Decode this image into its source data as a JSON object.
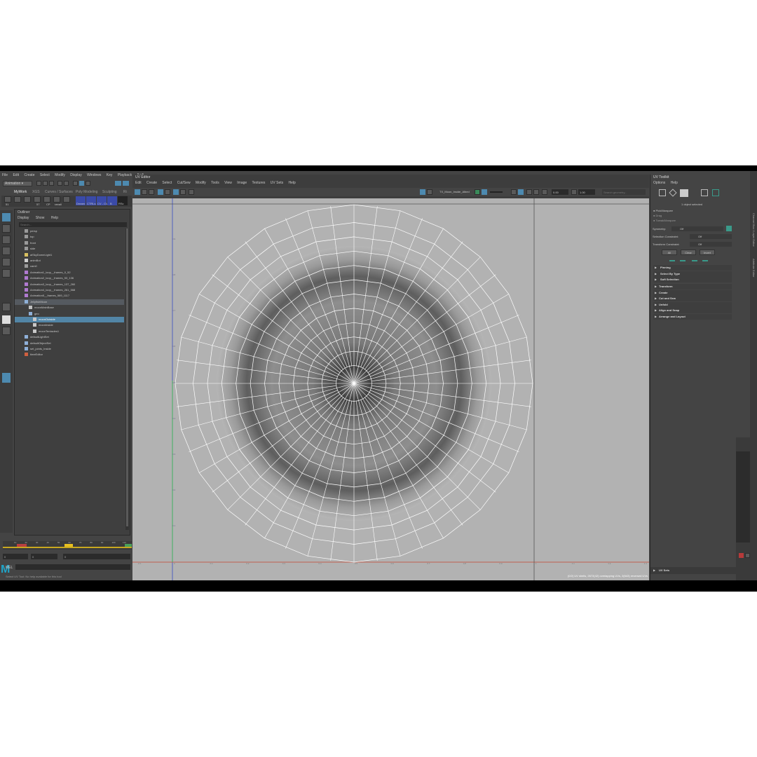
{
  "main_menu": [
    "File",
    "Edit",
    "Create",
    "Select",
    "Modify",
    "Display",
    "Windows",
    "Key",
    "Playback",
    "Audi"
  ],
  "mode_menu": "Animation",
  "shelf_tabs": [
    "MyWork",
    "XGS",
    "Curves / Surfaces",
    "Poly Modeling",
    "Sculpting",
    "Ri"
  ],
  "shelf_buttons": [
    "Dream",
    "CTRLs",
    "CV - CV",
    "B",
    "RSc"
  ],
  "numeric_labels": {
    "a": "51",
    "b": "57",
    "c": "CP",
    "d": "ranall"
  },
  "outliner": {
    "title": "Outliner",
    "menu": [
      "Display",
      "Show",
      "Help"
    ],
    "search_placeholder": "Search...",
    "items": [
      {
        "label": "persp",
        "kind": "camera",
        "indent": 0
      },
      {
        "label": "top",
        "kind": "camera",
        "indent": 0
      },
      {
        "label": "front",
        "kind": "camera",
        "indent": 0
      },
      {
        "label": "side",
        "kind": "camera",
        "indent": 0
      },
      {
        "label": "aiSkyDomeLight1",
        "kind": "light",
        "indent": 0
      },
      {
        "label": "animBot",
        "kind": "magnet",
        "indent": 0
      },
      {
        "label": "cam0",
        "kind": "camera",
        "indent": 0
      },
      {
        "label": "Animation1_loop__frames_0_52",
        "kind": "anim",
        "indent": 0
      },
      {
        "label": "Animation2_loop__frames_53_136",
        "kind": "anim",
        "indent": 0
      },
      {
        "label": "Animation3_loop__frames_137_260",
        "kind": "anim",
        "indent": 0
      },
      {
        "label": "Animation4_loop__frames_261_568",
        "kind": "anim",
        "indent": 0
      },
      {
        "label": "Animation5__frames_569_1117",
        "kind": "anim",
        "indent": 0
      },
      {
        "label": "JellyfishMoon",
        "kind": "group",
        "indent": 0,
        "hl": true
      },
      {
        "label": "moonMainBase",
        "kind": "joint",
        "indent": 1
      },
      {
        "label": "geo",
        "kind": "group",
        "indent": 1
      },
      {
        "label": "moonOutside",
        "kind": "mesh",
        "indent": 2,
        "sel": true
      },
      {
        "label": "moonInside",
        "kind": "mesh",
        "indent": 2
      },
      {
        "label": "moonTentacles1",
        "kind": "mesh",
        "indent": 2
      },
      {
        "label": "defaultLightSet",
        "kind": "set",
        "indent": 0
      },
      {
        "label": "defaultObjectSet",
        "kind": "set",
        "indent": 0
      },
      {
        "label": "set_joints_Inside",
        "kind": "set",
        "indent": 0
      },
      {
        "label": "timeEditor",
        "kind": "time",
        "indent": 0
      }
    ]
  },
  "timeline": {
    "ticks": [
      "10",
      "20",
      "30",
      "40",
      "50",
      "60",
      "70",
      "80",
      "90",
      "100",
      "110"
    ],
    "field_a": "0",
    "field_b": "0",
    "field_c": "0"
  },
  "mel_label": "MEL",
  "help_line": "Select UV Tool: No help available for this tool",
  "uv_editor": {
    "title": "UV Editor",
    "menu": [
      "Edit",
      "Create",
      "Select",
      "Cut/Sew",
      "Modify",
      "Tools",
      "View",
      "Image",
      "Textures",
      "UV Sets",
      "Help"
    ],
    "texture_name": "TX_Moon_Inside_Albed",
    "field_1": "0.00",
    "field_2": "1.00",
    "search_placeholder": "Search geometry...",
    "v_ticks": [
      "0.9",
      "0.8",
      "0.7",
      "0.6",
      "0.5",
      "0.4",
      "0.3",
      "0.2",
      "0.1"
    ],
    "u_ticks": [
      "-0.1",
      "0",
      "0.1",
      "0.2",
      "0.3",
      "0.4",
      "0.5",
      "0.6",
      "0.7",
      "0.8",
      "0.9",
      "1",
      "1.1",
      "1.2",
      "1.3"
    ],
    "status": "(0/2) UV shells, 2672(42) overlapping UVs, 2(643) reversed UVs"
  },
  "uv_toolkit": {
    "title": "UV Toolkit",
    "menu": [
      "Options",
      "Help"
    ],
    "selected_text": "1 object selected",
    "select_modes": [
      "Pick/Marquee",
      "Drag",
      "Tweak/Marquee"
    ],
    "symmetry_label": "Symmetry:",
    "symmetry_value": "Off",
    "selection_constraint_label": "Selection Constraint:",
    "selection_constraint_value": "Off",
    "transform_constraint_label": "Transform Constraint:",
    "transform_constraint_value": "Off",
    "buttons": [
      "All",
      "Clear",
      "Invert"
    ],
    "sections_top": [
      "Pinning",
      "Select By Type",
      "Soft Selection"
    ],
    "sections": [
      "Transform",
      "Create",
      "Cut and Sew",
      "Unfold",
      "Align and Snap",
      "Arrange and Layout"
    ],
    "uv_sets": "UV Sets"
  },
  "right_strip": [
    "Channel Box / Layer Editor",
    "Attribute Editor"
  ],
  "colors": {
    "accent": "#4d8ab0",
    "panel": "#444444",
    "canvas": "#b2b2b2",
    "wire": "#ffffff",
    "selected_row": "#5285a6"
  }
}
